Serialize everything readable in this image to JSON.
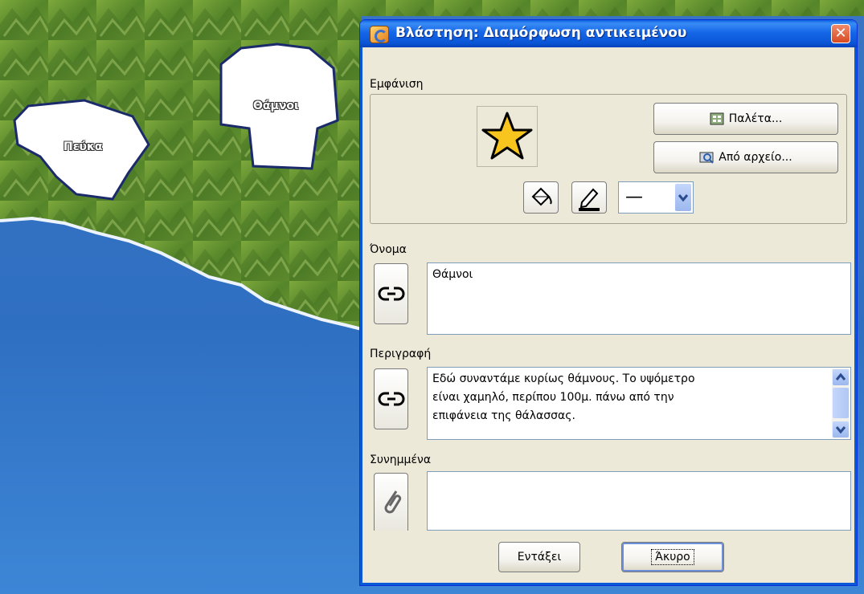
{
  "map": {
    "region_pine_label": "Πεύκα",
    "region_shrubs_label": "Θάμνοι"
  },
  "dialog": {
    "title": "Βλάστηση: Διαμόρφωση αντικειμένου",
    "close_glyph": "✕",
    "appearance": {
      "label": "Εμφάνιση",
      "palette_button": "Παλέτα...",
      "from_file_button": "Από αρχείο...",
      "line_style_value": "—"
    },
    "name": {
      "label": "Όνομα",
      "value": "Θάμνοι"
    },
    "description": {
      "label": "Περιγραφή",
      "line1": "Εδώ συναντάμε κυρίως θάμνους. Το υψόμετρο",
      "line2": "είναι χαμηλό, περίπου 100μ. πάνω από την",
      "line3": "επιφάνεια της θάλασσας."
    },
    "attachments": {
      "label": "Συνημμένα",
      "value": ""
    },
    "ok_button": "Εντάξει",
    "cancel_button": "Άκυρο"
  },
  "colors": {
    "sea": "#2f6fc2",
    "land": "#5d8a2c",
    "titlebar": "#0a55d6",
    "dialog_bg": "#ece9d8",
    "star_fill": "#f7c51e"
  },
  "icons": [
    "app-icon",
    "close-icon",
    "star-icon",
    "palette-icon",
    "file-icon",
    "fill-icon",
    "pen-icon",
    "link-icon",
    "paperclip-icon"
  ]
}
